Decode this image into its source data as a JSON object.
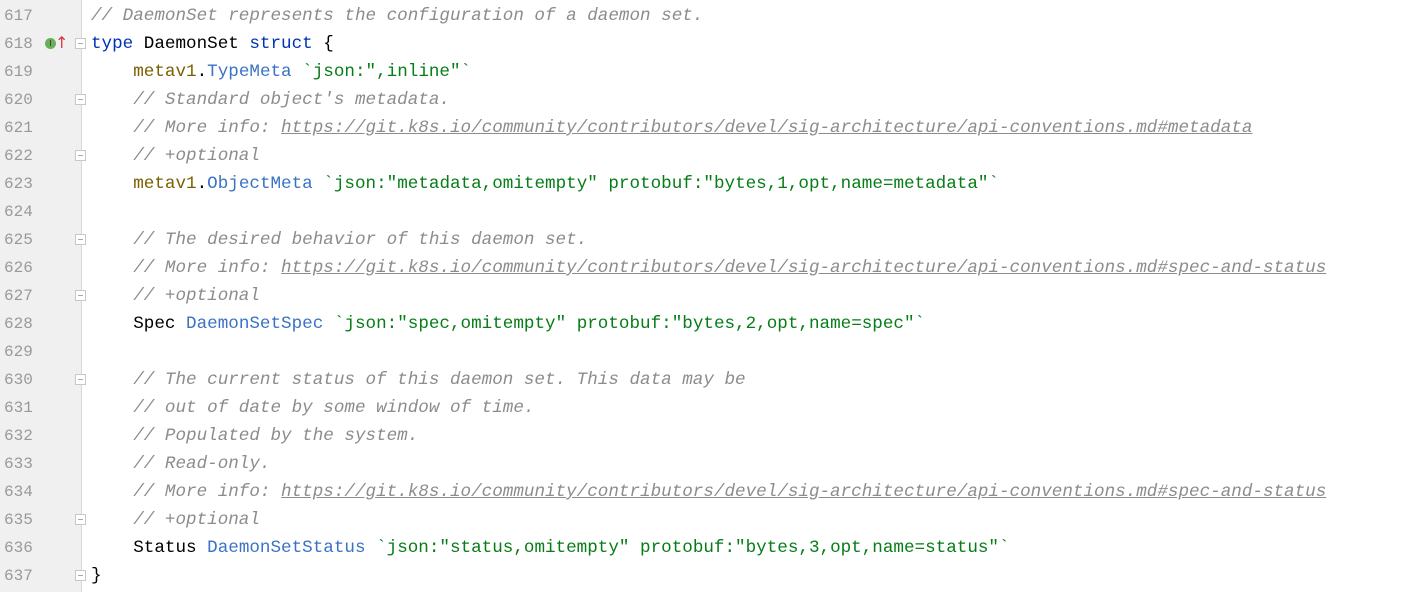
{
  "lines": [
    {
      "n": "617",
      "parts": [
        {
          "t": "// DaemonSet represents the configuration of a daemon set.",
          "k": "c"
        }
      ]
    },
    {
      "n": "618",
      "parts": [
        {
          "t": "type",
          "k": "kw"
        },
        {
          "t": " DaemonSet ",
          "k": ""
        },
        {
          "t": "struct",
          "k": "kw"
        },
        {
          "t": " {",
          "k": ""
        }
      ],
      "fold": true,
      "marker": true
    },
    {
      "n": "619",
      "parts": [
        {
          "t": "    ",
          "k": ""
        },
        {
          "t": "metav1",
          "k": "pkg"
        },
        {
          "t": ".",
          "k": ""
        },
        {
          "t": "TypeMeta",
          "k": "ty"
        },
        {
          "t": " `json:\",inline\"`",
          "k": "str"
        }
      ]
    },
    {
      "n": "620",
      "parts": [
        {
          "t": "    // Standard object's metadata.",
          "k": "c"
        }
      ],
      "fold": true
    },
    {
      "n": "621",
      "parts": [
        {
          "t": "    // More info: ",
          "k": "c"
        },
        {
          "t": "https://git.k8s.io/community/contributors/devel/sig-architecture/api-conventions.md#metadata",
          "k": "c u"
        }
      ]
    },
    {
      "n": "622",
      "parts": [
        {
          "t": "    // +optional",
          "k": "c"
        }
      ],
      "fold": true
    },
    {
      "n": "623",
      "parts": [
        {
          "t": "    ",
          "k": ""
        },
        {
          "t": "metav1",
          "k": "pkg"
        },
        {
          "t": ".",
          "k": ""
        },
        {
          "t": "ObjectMeta",
          "k": "ty"
        },
        {
          "t": " `json:\"metadata,omitempty\" protobuf:\"bytes,1,opt,name=metadata\"`",
          "k": "str"
        }
      ]
    },
    {
      "n": "624",
      "parts": []
    },
    {
      "n": "625",
      "parts": [
        {
          "t": "    // The desired behavior of this daemon set.",
          "k": "c"
        }
      ],
      "fold": true
    },
    {
      "n": "626",
      "parts": [
        {
          "t": "    // More info: ",
          "k": "c"
        },
        {
          "t": "https://git.k8s.io/community/contributors/devel/sig-architecture/api-conventions.md#spec-and-status",
          "k": "c u"
        }
      ]
    },
    {
      "n": "627",
      "parts": [
        {
          "t": "    // +optional",
          "k": "c"
        }
      ],
      "fold": true
    },
    {
      "n": "628",
      "parts": [
        {
          "t": "    Spec ",
          "k": ""
        },
        {
          "t": "DaemonSetSpec",
          "k": "ty"
        },
        {
          "t": " `json:\"spec,omitempty\" protobuf:\"bytes,2,opt,name=spec\"`",
          "k": "str"
        }
      ]
    },
    {
      "n": "629",
      "parts": []
    },
    {
      "n": "630",
      "parts": [
        {
          "t": "    // The current status of this daemon set. This data may be",
          "k": "c"
        }
      ],
      "fold": true
    },
    {
      "n": "631",
      "parts": [
        {
          "t": "    // out of date by some window of time.",
          "k": "c"
        }
      ]
    },
    {
      "n": "632",
      "parts": [
        {
          "t": "    // Populated by the system.",
          "k": "c"
        }
      ]
    },
    {
      "n": "633",
      "parts": [
        {
          "t": "    // Read-only.",
          "k": "c"
        }
      ]
    },
    {
      "n": "634",
      "parts": [
        {
          "t": "    // More info: ",
          "k": "c"
        },
        {
          "t": "https://git.k8s.io/community/contributors/devel/sig-architecture/api-conventions.md#spec-and-status",
          "k": "c u"
        }
      ]
    },
    {
      "n": "635",
      "parts": [
        {
          "t": "    // +optional",
          "k": "c"
        }
      ],
      "fold": true
    },
    {
      "n": "636",
      "parts": [
        {
          "t": "    Status ",
          "k": ""
        },
        {
          "t": "DaemonSetStatus",
          "k": "ty"
        },
        {
          "t": " `json:\"status,omitempty\" protobuf:\"bytes,3,opt,name=status\"`",
          "k": "str"
        }
      ]
    },
    {
      "n": "637",
      "parts": [
        {
          "t": "}",
          "k": ""
        }
      ],
      "fold": true
    }
  ],
  "gutter": {
    "implemented_marker": "I",
    "arrow_icon": "↑"
  }
}
